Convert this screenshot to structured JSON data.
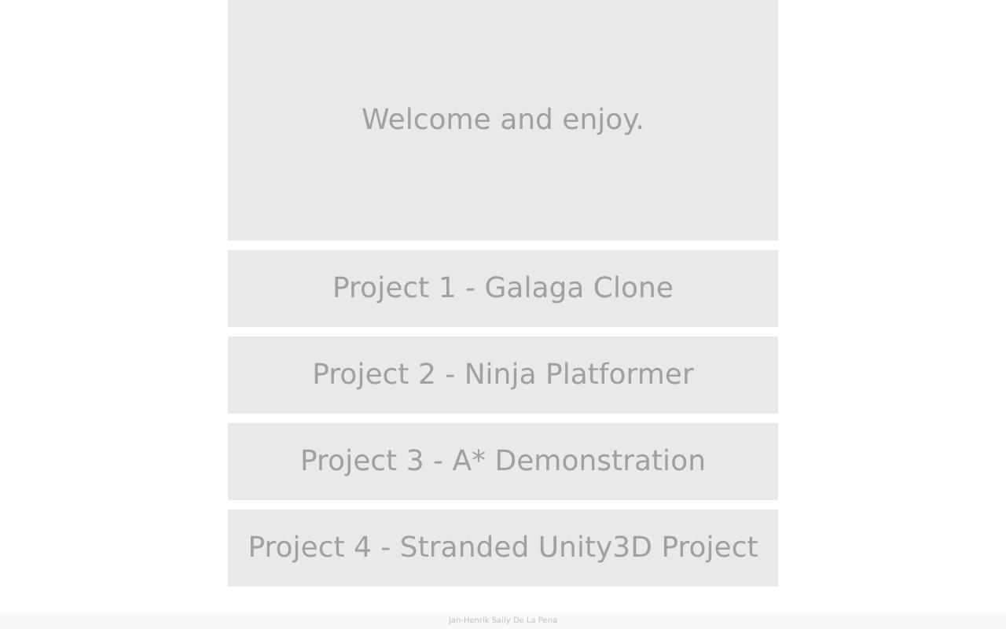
{
  "hero": {
    "text": "Welcome and enjoy."
  },
  "projects": [
    {
      "label": "Project 1 - Galaga Clone"
    },
    {
      "label": "Project 2 - Ninja Platformer"
    },
    {
      "label": "Project 3 - A* Demonstration"
    },
    {
      "label": "Project 4 - Stranded Unity3D Project"
    }
  ],
  "footer": {
    "text": "Jan-Henrik Saily De La Pena"
  }
}
